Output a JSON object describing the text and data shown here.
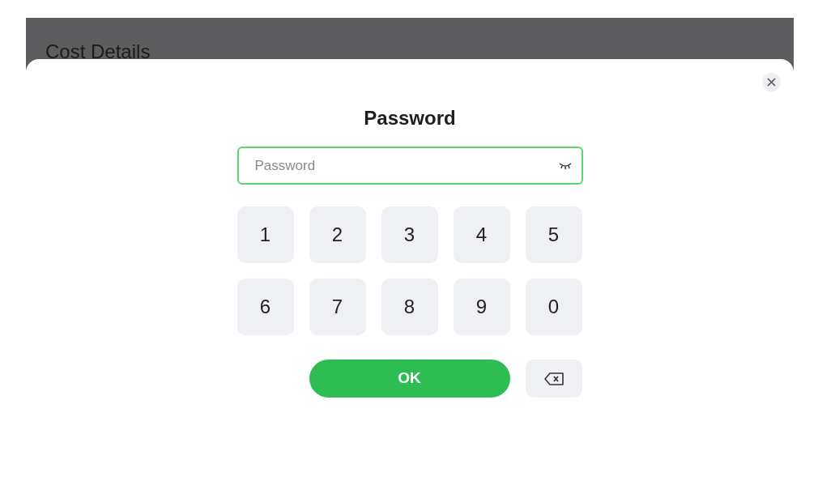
{
  "page": {
    "title": "Cost Details"
  },
  "dialog": {
    "title": "Password",
    "password_field": {
      "placeholder": "Password"
    },
    "keys": [
      "1",
      "2",
      "3",
      "4",
      "5",
      "6",
      "7",
      "8",
      "9",
      "0"
    ],
    "ok_button": "OK"
  }
}
